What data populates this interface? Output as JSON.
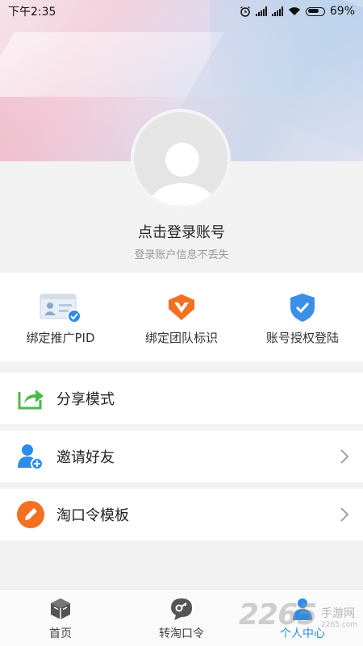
{
  "status_bar": {
    "time": "下午2:35",
    "battery": "69%"
  },
  "profile": {
    "login_title": "点击登录账号",
    "login_subtitle": "登录账户信息不丢失"
  },
  "quick_actions": [
    {
      "label": "绑定推广PID",
      "icon": "id-card-icon"
    },
    {
      "label": "绑定团队标识",
      "icon": "v-badge-icon"
    },
    {
      "label": "账号授权登陆",
      "icon": "shield-check-icon"
    }
  ],
  "menu": [
    {
      "label": "分享模式",
      "icon": "share-icon",
      "color": "#4cb84a"
    },
    {
      "label": "邀请好友",
      "icon": "add-user-icon",
      "color": "#2b8de8"
    },
    {
      "label": "淘口令模板",
      "icon": "pencil-icon",
      "color": "#f37022"
    }
  ],
  "bottom_nav": [
    {
      "label": "首页",
      "icon": "home-box-icon"
    },
    {
      "label": "转淘口令",
      "icon": "chat-key-icon"
    },
    {
      "label": "个人中心",
      "icon": "person-icon",
      "active": true
    }
  ],
  "watermark": {
    "brand": "2265",
    "name": "手游网",
    "url": "2265.com"
  },
  "colors": {
    "accent": "#2b8de8",
    "orange": "#f37022",
    "green": "#4cb84a"
  }
}
